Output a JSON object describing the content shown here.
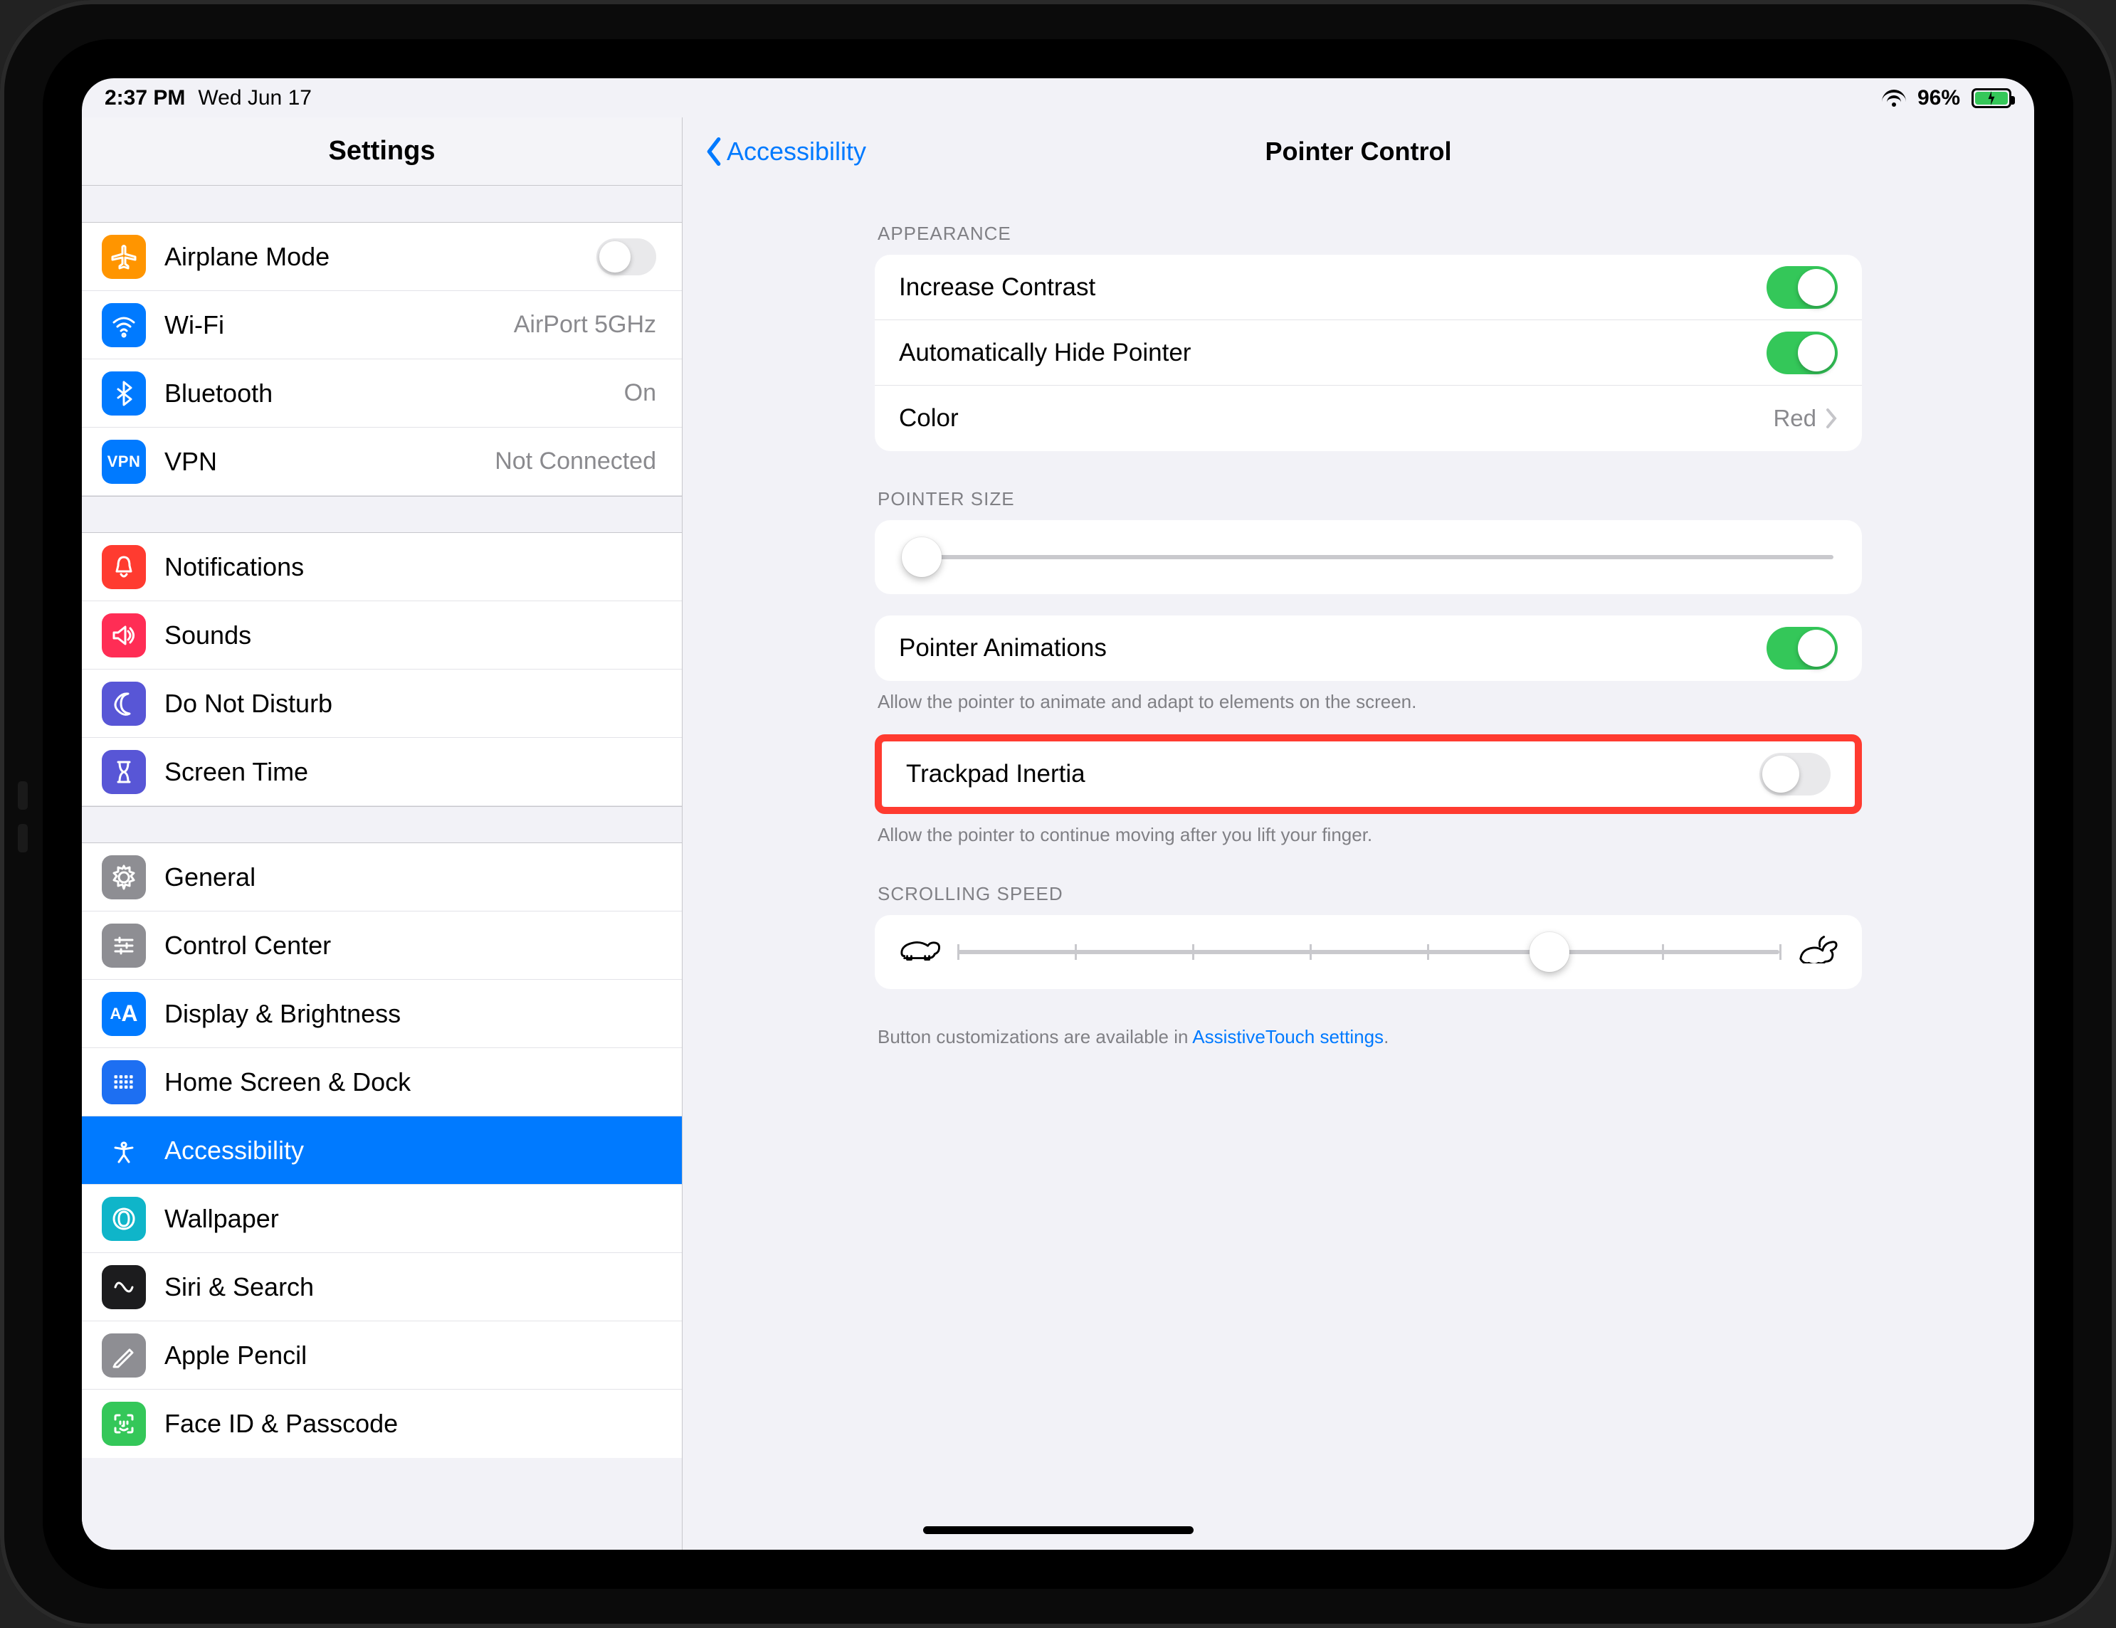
{
  "status": {
    "time": "2:37 PM",
    "date": "Wed Jun 17",
    "battery_pct": "96%"
  },
  "sidebar": {
    "title": "Settings",
    "groups": [
      [
        {
          "icon": "airplane-icon",
          "color": "i-orange",
          "label": "Airplane Mode",
          "detail": "",
          "toggle": "off"
        },
        {
          "icon": "wifi-icon",
          "color": "i-blue",
          "label": "Wi-Fi",
          "detail": "AirPort 5GHz"
        },
        {
          "icon": "bluetooth-icon",
          "color": "i-blue",
          "label": "Bluetooth",
          "detail": "On"
        },
        {
          "icon": "vpn-icon",
          "color": "i-blue",
          "label": "VPN",
          "detail": "Not Connected"
        }
      ],
      [
        {
          "icon": "bell-icon",
          "color": "i-red",
          "label": "Notifications"
        },
        {
          "icon": "speaker-icon",
          "color": "i-pink",
          "label": "Sounds"
        },
        {
          "icon": "moon-icon",
          "color": "i-purple",
          "label": "Do Not Disturb"
        },
        {
          "icon": "hourglass-icon",
          "color": "i-purple",
          "label": "Screen Time"
        }
      ],
      [
        {
          "icon": "gear-icon",
          "color": "i-gray",
          "label": "General"
        },
        {
          "icon": "sliders-icon",
          "color": "i-gray",
          "label": "Control Center"
        },
        {
          "icon": "text-size-icon",
          "color": "i-blue",
          "label": "Display & Brightness"
        },
        {
          "icon": "apps-icon",
          "color": "i-deepblue",
          "label": "Home Screen & Dock"
        },
        {
          "icon": "accessibility-icon",
          "color": "i-blue",
          "label": "Accessibility",
          "selected": true
        },
        {
          "icon": "wallpaper-icon",
          "color": "i-teal",
          "label": "Wallpaper"
        },
        {
          "icon": "siri-icon",
          "color": "i-dark",
          "label": "Siri & Search"
        },
        {
          "icon": "pencil-icon",
          "color": "i-gray",
          "label": "Apple Pencil"
        },
        {
          "icon": "faceid-icon",
          "color": "i-green",
          "label": "Face ID & Passcode"
        }
      ]
    ]
  },
  "page": {
    "back": "Accessibility",
    "title": "Pointer Control",
    "appearance_header": "APPEARANCE",
    "rows": {
      "increase_contrast": "Increase Contrast",
      "auto_hide": "Automatically Hide Pointer",
      "color": "Color",
      "color_value": "Red"
    },
    "pointer_size_header": "POINTER SIZE",
    "pointer_animations": "Pointer Animations",
    "pointer_animations_note": "Allow the pointer to animate and adapt to elements on the screen.",
    "trackpad_inertia": "Trackpad Inertia",
    "trackpad_inertia_note": "Allow the pointer to continue moving after you lift your finger.",
    "scrolling_header": "SCROLLING SPEED",
    "footer_pre": "Button customizations are available in ",
    "footer_link": "AssistiveTouch settings",
    "footer_post": ".",
    "switches": {
      "increase_contrast": "on",
      "auto_hide": "on",
      "pointer_animations": "on",
      "trackpad_inertia": "off"
    },
    "pointer_size_value": 0.02,
    "scrolling_value": 0.72
  }
}
